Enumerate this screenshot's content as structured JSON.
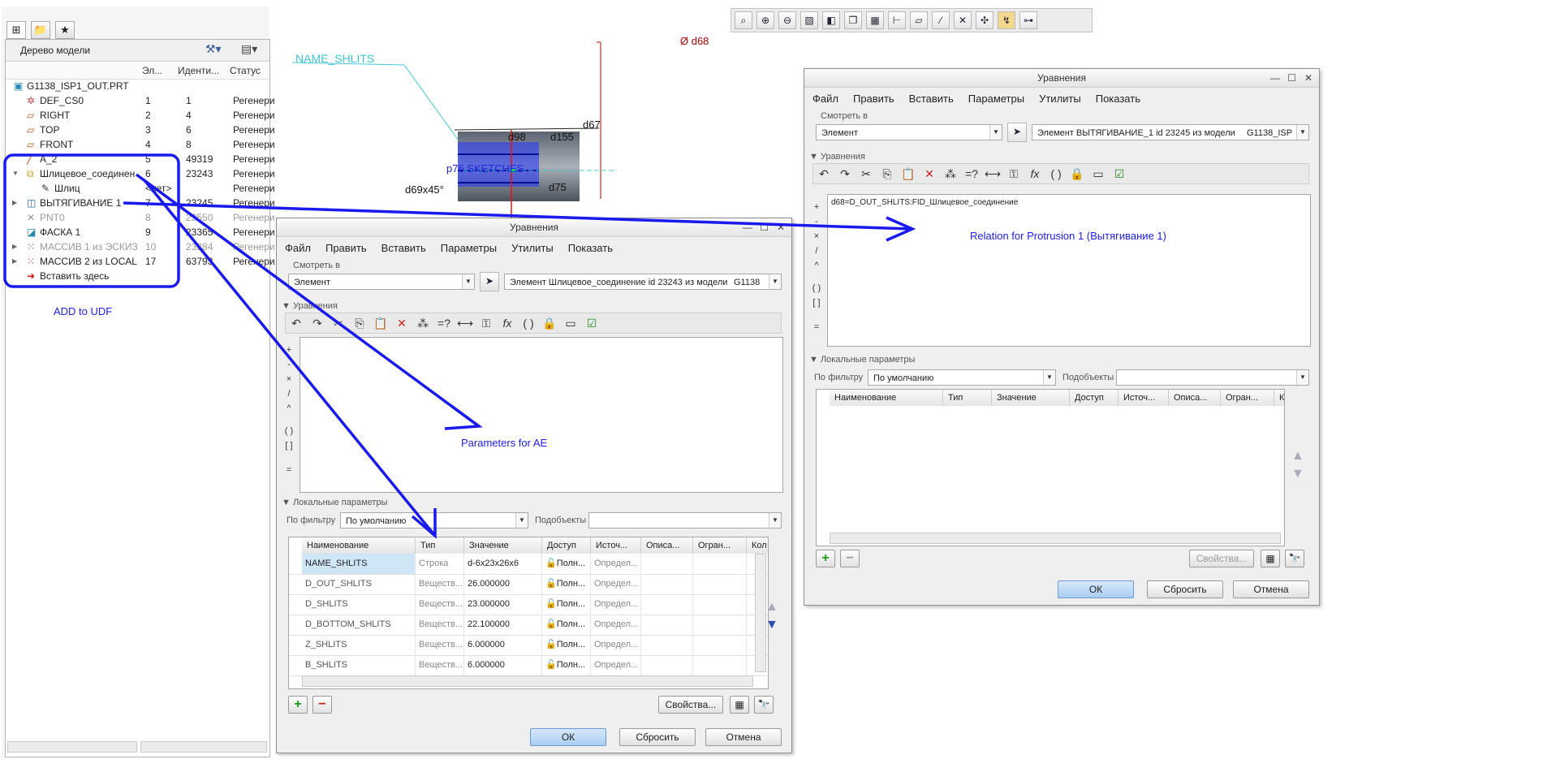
{
  "top_toolbar": {
    "icons": [
      "zoom-fit-icon",
      "zoom-in-icon",
      "zoom-out-icon",
      "repaint-icon",
      "view-orient-icon",
      "saved-views-icon",
      "display-style-icon",
      "datum-axis-icon",
      "datum-plane-icon",
      "datum-point-icon",
      "csys-display-icon",
      "annotation-icon",
      "spin-center-icon",
      "model-tree-toggle-icon"
    ]
  },
  "model_tree": {
    "title": "Дерево модели",
    "columns": [
      "Эл...",
      "Иденти...",
      "Статус"
    ],
    "rows": [
      {
        "name": "G1138_ISP1_OUT.PRT",
        "num": "",
        "id": "",
        "status": "",
        "icon": "part-icon",
        "expander": ""
      },
      {
        "name": "DEF_CS0",
        "num": "1",
        "id": "1",
        "status": "Регенери",
        "icon": "csys-icon",
        "expander": ""
      },
      {
        "name": "RIGHT",
        "num": "2",
        "id": "4",
        "status": "Регенери",
        "icon": "plane-icon",
        "expander": ""
      },
      {
        "name": "TOP",
        "num": "3",
        "id": "6",
        "status": "Регенери",
        "icon": "plane-icon",
        "expander": ""
      },
      {
        "name": "FRONT",
        "num": "4",
        "id": "8",
        "status": "Регенери",
        "icon": "plane-icon",
        "expander": ""
      },
      {
        "name": "A_2",
        "num": "5",
        "id": "49319",
        "status": "Регенери",
        "icon": "axis-icon",
        "expander": ""
      },
      {
        "name": "Шлицевое_соединен",
        "num": "6",
        "id": "23243",
        "status": "Регенери",
        "icon": "udf-icon",
        "expander": "▼"
      },
      {
        "name": "Шлиц",
        "num": "<нет>",
        "id": "",
        "status": "Регенери",
        "icon": "sketch-icon",
        "expander": ""
      },
      {
        "name": "ВЫТЯГИВАНИЕ 1",
        "num": "7",
        "id": "23245",
        "status": "Регенери",
        "icon": "extrude-icon",
        "expander": "▶"
      },
      {
        "name": "PNT0",
        "num": "8",
        "id": "23550",
        "status": "Регенери",
        "icon": "point-icon",
        "expander": ""
      },
      {
        "name": "ФАСКА 1",
        "num": "9",
        "id": "23365",
        "status": "Регенери",
        "icon": "chamfer-icon",
        "expander": ""
      },
      {
        "name": "МАССИВ 1 из ЭСКИЗ",
        "num": "10",
        "id": "23284",
        "status": "Регенери",
        "icon": "pattern-icon",
        "expander": "▶"
      },
      {
        "name": "МАССИВ 2 из LOCAL",
        "num": "17",
        "id": "63793",
        "status": "Регенери",
        "icon": "pattern-icon",
        "expander": "▶"
      },
      {
        "name": "Вставить здесь",
        "num": "",
        "id": "",
        "status": "",
        "icon": "insert-arrow-icon",
        "expander": ""
      }
    ]
  },
  "annotations": {
    "add_to_udf": "ADD to UDF",
    "parameters_for_ae": "Parameters for AE",
    "relation_for_protrusion": "Relation for Protrusion 1 (Вытягивание 1)"
  },
  "model_view": {
    "name_shlits": "NAME_SHLITS",
    "d68": "Ø d68",
    "d67": "d67",
    "d98": "d98",
    "d155": "d155",
    "p76": "p76 SKETCHES",
    "d69": "d69x45°",
    "d75": "d75"
  },
  "dialog_left": {
    "title": "Уравнения",
    "menu": [
      "Файл",
      "Править",
      "Вставить",
      "Параметры",
      "Утилиты",
      "Показать"
    ],
    "look_in_label": "Смотреть в",
    "look_in_value": "Элемент",
    "element_value": "Элемент Шлицевое_соединение id 23243 из модели",
    "model_value": "G1138",
    "relations_label": "Уравнения",
    "relation_text": "",
    "side_ops": [
      "+",
      "-",
      "×",
      "/",
      "^",
      "( )",
      "[ ]",
      "="
    ],
    "local_params_label": "Локальные параметры",
    "filter_label": "По фильтру",
    "filter_value": "По умолчанию",
    "subobjects_label": "Подобъекты",
    "columns": [
      "Наименование",
      "Тип",
      "Значение",
      "Доступ",
      "Источ...",
      "Описа...",
      "Огран...",
      "Кол"
    ],
    "params": [
      {
        "name": "NAME_SHLITS",
        "type": "Строка",
        "value": "d-6x23x26x6",
        "access": "Полн...",
        "source": "Определ..."
      },
      {
        "name": "D_OUT_SHLITS",
        "type": "Веществ...",
        "value": "26.000000",
        "access": "Полн...",
        "source": "Определ..."
      },
      {
        "name": "D_SHLITS",
        "type": "Веществ...",
        "value": "23.000000",
        "access": "Полн...",
        "source": "Определ..."
      },
      {
        "name": "D_BOTTOM_SHLITS",
        "type": "Веществ...",
        "value": "22.100000",
        "access": "Полн...",
        "source": "Определ..."
      },
      {
        "name": "Z_SHLITS",
        "type": "Веществ...",
        "value": "6.000000",
        "access": "Полн...",
        "source": "Определ..."
      },
      {
        "name": "B_SHLITS",
        "type": "Веществ...",
        "value": "6.000000",
        "access": "Полн...",
        "source": "Определ..."
      }
    ],
    "properties_button": "Свойства...",
    "ok_button": "ОК",
    "reset_button": "Сбросить",
    "cancel_button": "Отмена"
  },
  "dialog_right": {
    "title": "Уравнения",
    "menu": [
      "Файл",
      "Править",
      "Вставить",
      "Параметры",
      "Утилиты",
      "Показать"
    ],
    "look_in_label": "Смотреть в",
    "look_in_value": "Элемент",
    "element_value": "Элемент ВЫТЯГИВАНИЕ_1 id 23245 из модели",
    "model_value": "G1138_ISP",
    "relations_label": "Уравнения",
    "relation_text": "d68=D_OUT_SHLITS:FID_Шлицевое_соединение",
    "side_ops": [
      "+",
      "-",
      "×",
      "/",
      "^",
      "( )",
      "[ ]",
      "="
    ],
    "local_params_label": "Локальные параметры",
    "filter_label": "По фильтру",
    "filter_value": "По умолчанию",
    "subobjects_label": "Подобъекты",
    "columns": [
      "Наименование",
      "Тип",
      "Значение",
      "Доступ",
      "Источ...",
      "Описа...",
      "Огран...",
      "Колич"
    ],
    "properties_button": "Свойства...",
    "ok_button": "ОК",
    "reset_button": "Сбросить",
    "cancel_button": "Отмена"
  }
}
